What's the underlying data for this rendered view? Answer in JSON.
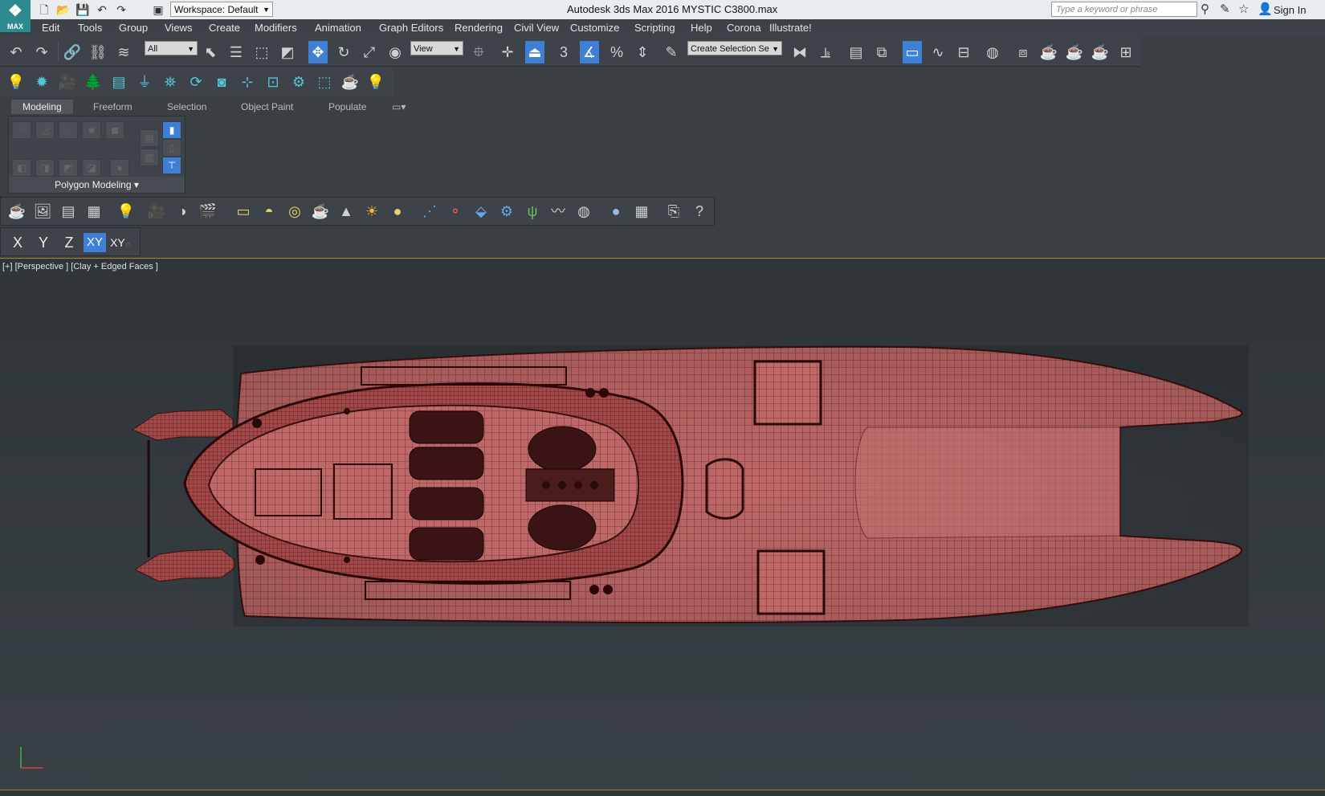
{
  "app": {
    "logo_text": "MAX",
    "workspace": "Workspace: Default",
    "title": "Autodesk 3ds Max 2016     MYSTIC C3800.max",
    "search_placeholder": "Type a keyword or phrase",
    "sign_in": "Sign In"
  },
  "menu": [
    "Edit",
    "Tools",
    "Group",
    "Views",
    "Create",
    "Modifiers",
    "Animation",
    "Graph Editors",
    "Rendering",
    "Civil View",
    "Customize",
    "Scripting",
    "Help",
    "Corona",
    "Illustrate!"
  ],
  "toolbar": {
    "selection_filter": "All",
    "ref_coord": "View",
    "named_selection": "Create Selection Se",
    "snap_label": "3"
  },
  "ribbon": {
    "tabs": [
      "Modeling",
      "Freeform",
      "Selection",
      "Object Paint",
      "Populate"
    ],
    "active_tab": "Modeling",
    "panel_label": "Polygon Modeling"
  },
  "axis_constraints": [
    "X",
    "Y",
    "Z",
    "XY",
    "XY"
  ],
  "viewport": {
    "label": "[+] [Perspective ] [Clay + Edged Faces ]",
    "model": "boat-hull",
    "accent_color": "#b15a5a",
    "wire_color": "#4a1818",
    "background": "#353c40"
  },
  "colors": {
    "accent_blue": "#3f7fd6",
    "logo_teal": "#2d8a8f"
  }
}
